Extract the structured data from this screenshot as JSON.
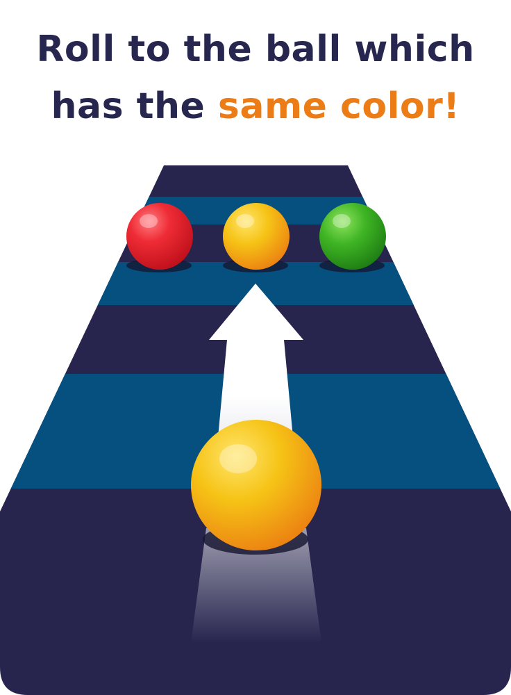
{
  "instruction": {
    "line1": "Roll to the ball which",
    "line2_start": "has the ",
    "line2_highlight": "same color!"
  },
  "colors": {
    "text_dark": "#26264f",
    "text_accent": "#ec7c16",
    "track_dark": "#27254e",
    "track_blue": "#06507f",
    "ball_red": "#e8202a",
    "ball_yellow": "#f5b812",
    "ball_green": "#35a61d",
    "arrow": "#ffffff"
  },
  "targets": [
    {
      "color_name": "red"
    },
    {
      "color_name": "yellow"
    },
    {
      "color_name": "green"
    }
  ],
  "player_ball": {
    "color_name": "yellow"
  }
}
